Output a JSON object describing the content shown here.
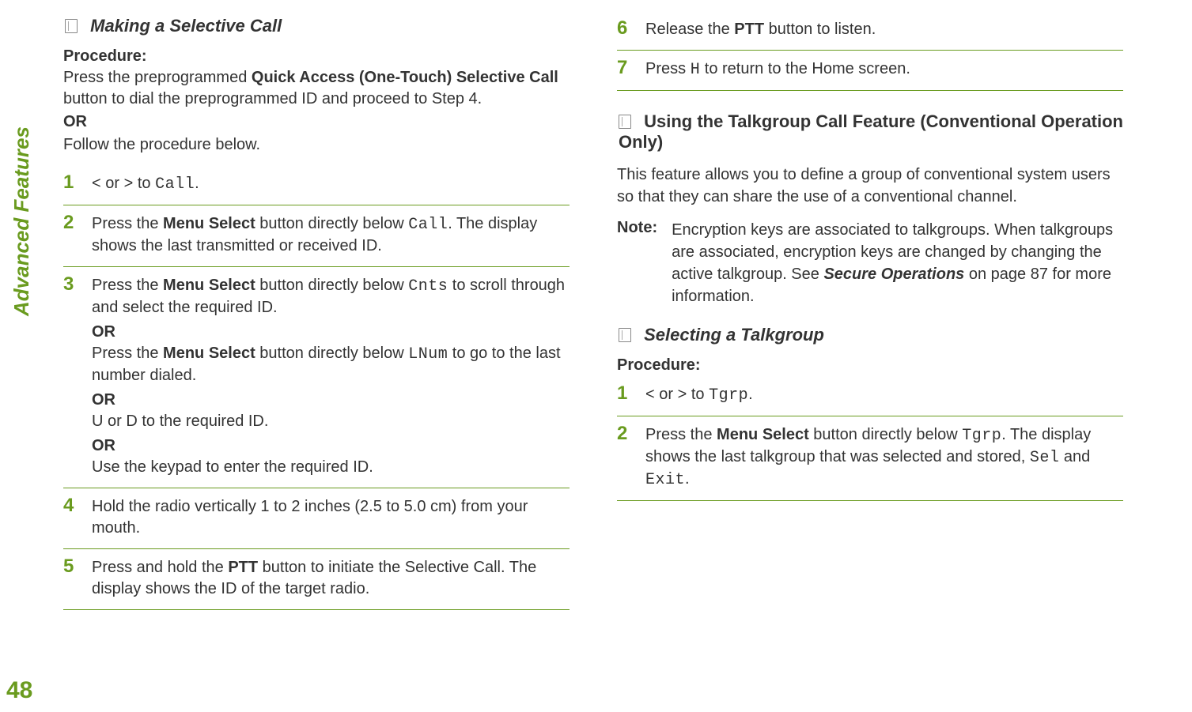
{
  "side_label": "Advanced Features",
  "page_number": "48",
  "left": {
    "heading": "Making a Selective Call",
    "procedure_label": "Procedure:",
    "intro_pre": "Press the preprogrammed ",
    "intro_bold": "Quick Access (One-Touch) Selective Call",
    "intro_post": " button to dial the preprogrammed ID and proceed to Step 4.",
    "or": "OR",
    "follow": "Follow the procedure below.",
    "steps": {
      "s1": {
        "num": "1",
        "pre": "< or > to ",
        "mono": "Call",
        "post": "."
      },
      "s2": {
        "num": "2",
        "pre": "Press the ",
        "bold": "Menu Select",
        "mid": " button directly below ",
        "mono": "Call",
        "post": ". The display shows the last transmitted or received ID."
      },
      "s3": {
        "num": "3",
        "a_pre": "Press the ",
        "a_bold": "Menu Select",
        "a_mid": " button directly below ",
        "a_mono": "Cnts",
        "a_post": " to scroll through and select the required ID.",
        "or1": "OR",
        "b_pre": "Press the ",
        "b_bold": "Menu Select",
        "b_mid": " button directly below ",
        "b_mono": "LNum",
        "b_post": " to go to the last number dialed.",
        "or2": "OR",
        "c": "U or D to the required ID.",
        "or3": "OR",
        "d": "Use the keypad to enter the required ID."
      },
      "s4": {
        "num": "4",
        "text": "Hold the radio vertically 1 to 2 inches (2.5 to 5.0 cm) from your mouth."
      },
      "s5": {
        "num": "5",
        "pre": "Press and hold the ",
        "bold": "PTT",
        "post": " button to initiate the Selective Call. The display shows the ID of the target radio."
      }
    }
  },
  "right": {
    "steps_cont": {
      "s6": {
        "num": "6",
        "pre": "Release the ",
        "bold": "PTT",
        "post": " button to listen."
      },
      "s7": {
        "num": "7",
        "pre": "Press ",
        "mono": "H",
        "post": " to return to the Home screen."
      }
    },
    "heading2": "Using the Talkgroup Call Feature (Conventional Operation Only)",
    "intro2": "This feature allows you to define a group of conventional system users so that they can share the use of a conventional channel.",
    "note_label": "Note:",
    "note_body_pre": "Encryption keys are associated to talkgroups. When talkgroups are associated, encryption keys are changed by changing the active talkgroup. See ",
    "note_body_bold": "Secure Operations",
    "note_body_post": " on page 87 for more information.",
    "heading3": "Selecting a Talkgroup",
    "procedure_label": "Procedure:",
    "tg_steps": {
      "s1": {
        "num": "1",
        "pre": "< or > to ",
        "mono": "Tgrp",
        "post": "."
      },
      "s2": {
        "num": "2",
        "pre": "Press the ",
        "bold": "Menu Select",
        "mid": " button directly below ",
        "mono": "Tgrp",
        "mid2": ". The display shows the last talkgroup that was selected and stored, ",
        "mono2": "Sel",
        "and": " and ",
        "mono3": "Exit",
        "post": "."
      }
    }
  }
}
